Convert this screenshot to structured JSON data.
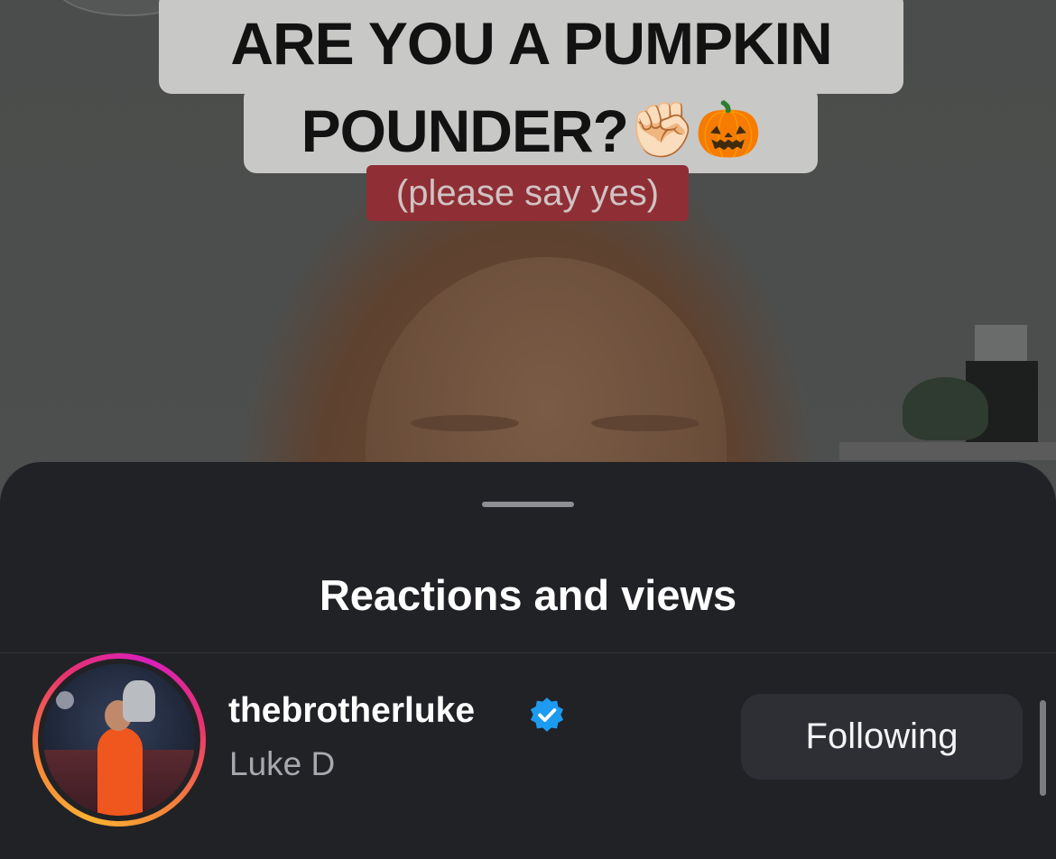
{
  "story": {
    "caption_line1": "ARE YOU A PUMPKIN",
    "caption_line2": "POUNDER?",
    "caption_emojis": [
      "✊🏻",
      "🎃"
    ],
    "subcaption": "(please say yes)"
  },
  "sheet": {
    "title": "Reactions and views"
  },
  "viewers": [
    {
      "username": "thebrotherluke",
      "full_name": "Luke D",
      "verified": true,
      "button_label": "Following"
    }
  ],
  "colors": {
    "sheet_bg": "#212226",
    "button_bg": "#2d2f35",
    "verified_blue": "#1d9bf0",
    "caption_red": "#8f2e34"
  }
}
